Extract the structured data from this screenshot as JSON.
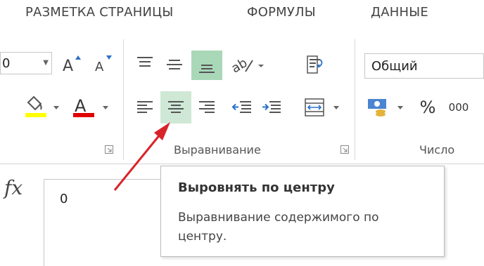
{
  "tabs": [
    {
      "label": "РАЗМЕТКА СТРАНИЦЫ"
    },
    {
      "label": "ФОРМУЛЫ"
    },
    {
      "label": "ДАННЫЕ"
    }
  ],
  "font": {
    "size_value": "0",
    "grow_label": "A",
    "shrink_label": "A",
    "color_label": "A",
    "fill_color": "#ffff00",
    "text_color": "#e00000"
  },
  "alignment": {
    "group_label": "Выравнивание"
  },
  "number": {
    "format_value": "Общий",
    "group_label": "Число",
    "percent_label": "%",
    "thousands_label": "000"
  },
  "formula_bar": {
    "fx_label": "fx",
    "value": "0"
  },
  "tooltip": {
    "title": "Выровнять по центру",
    "description": "Выравнивание содержимого по центру."
  },
  "colors": {
    "highlight": "#cfe8d6",
    "active": "#a9d8b8",
    "arrow": "#d9232a"
  }
}
